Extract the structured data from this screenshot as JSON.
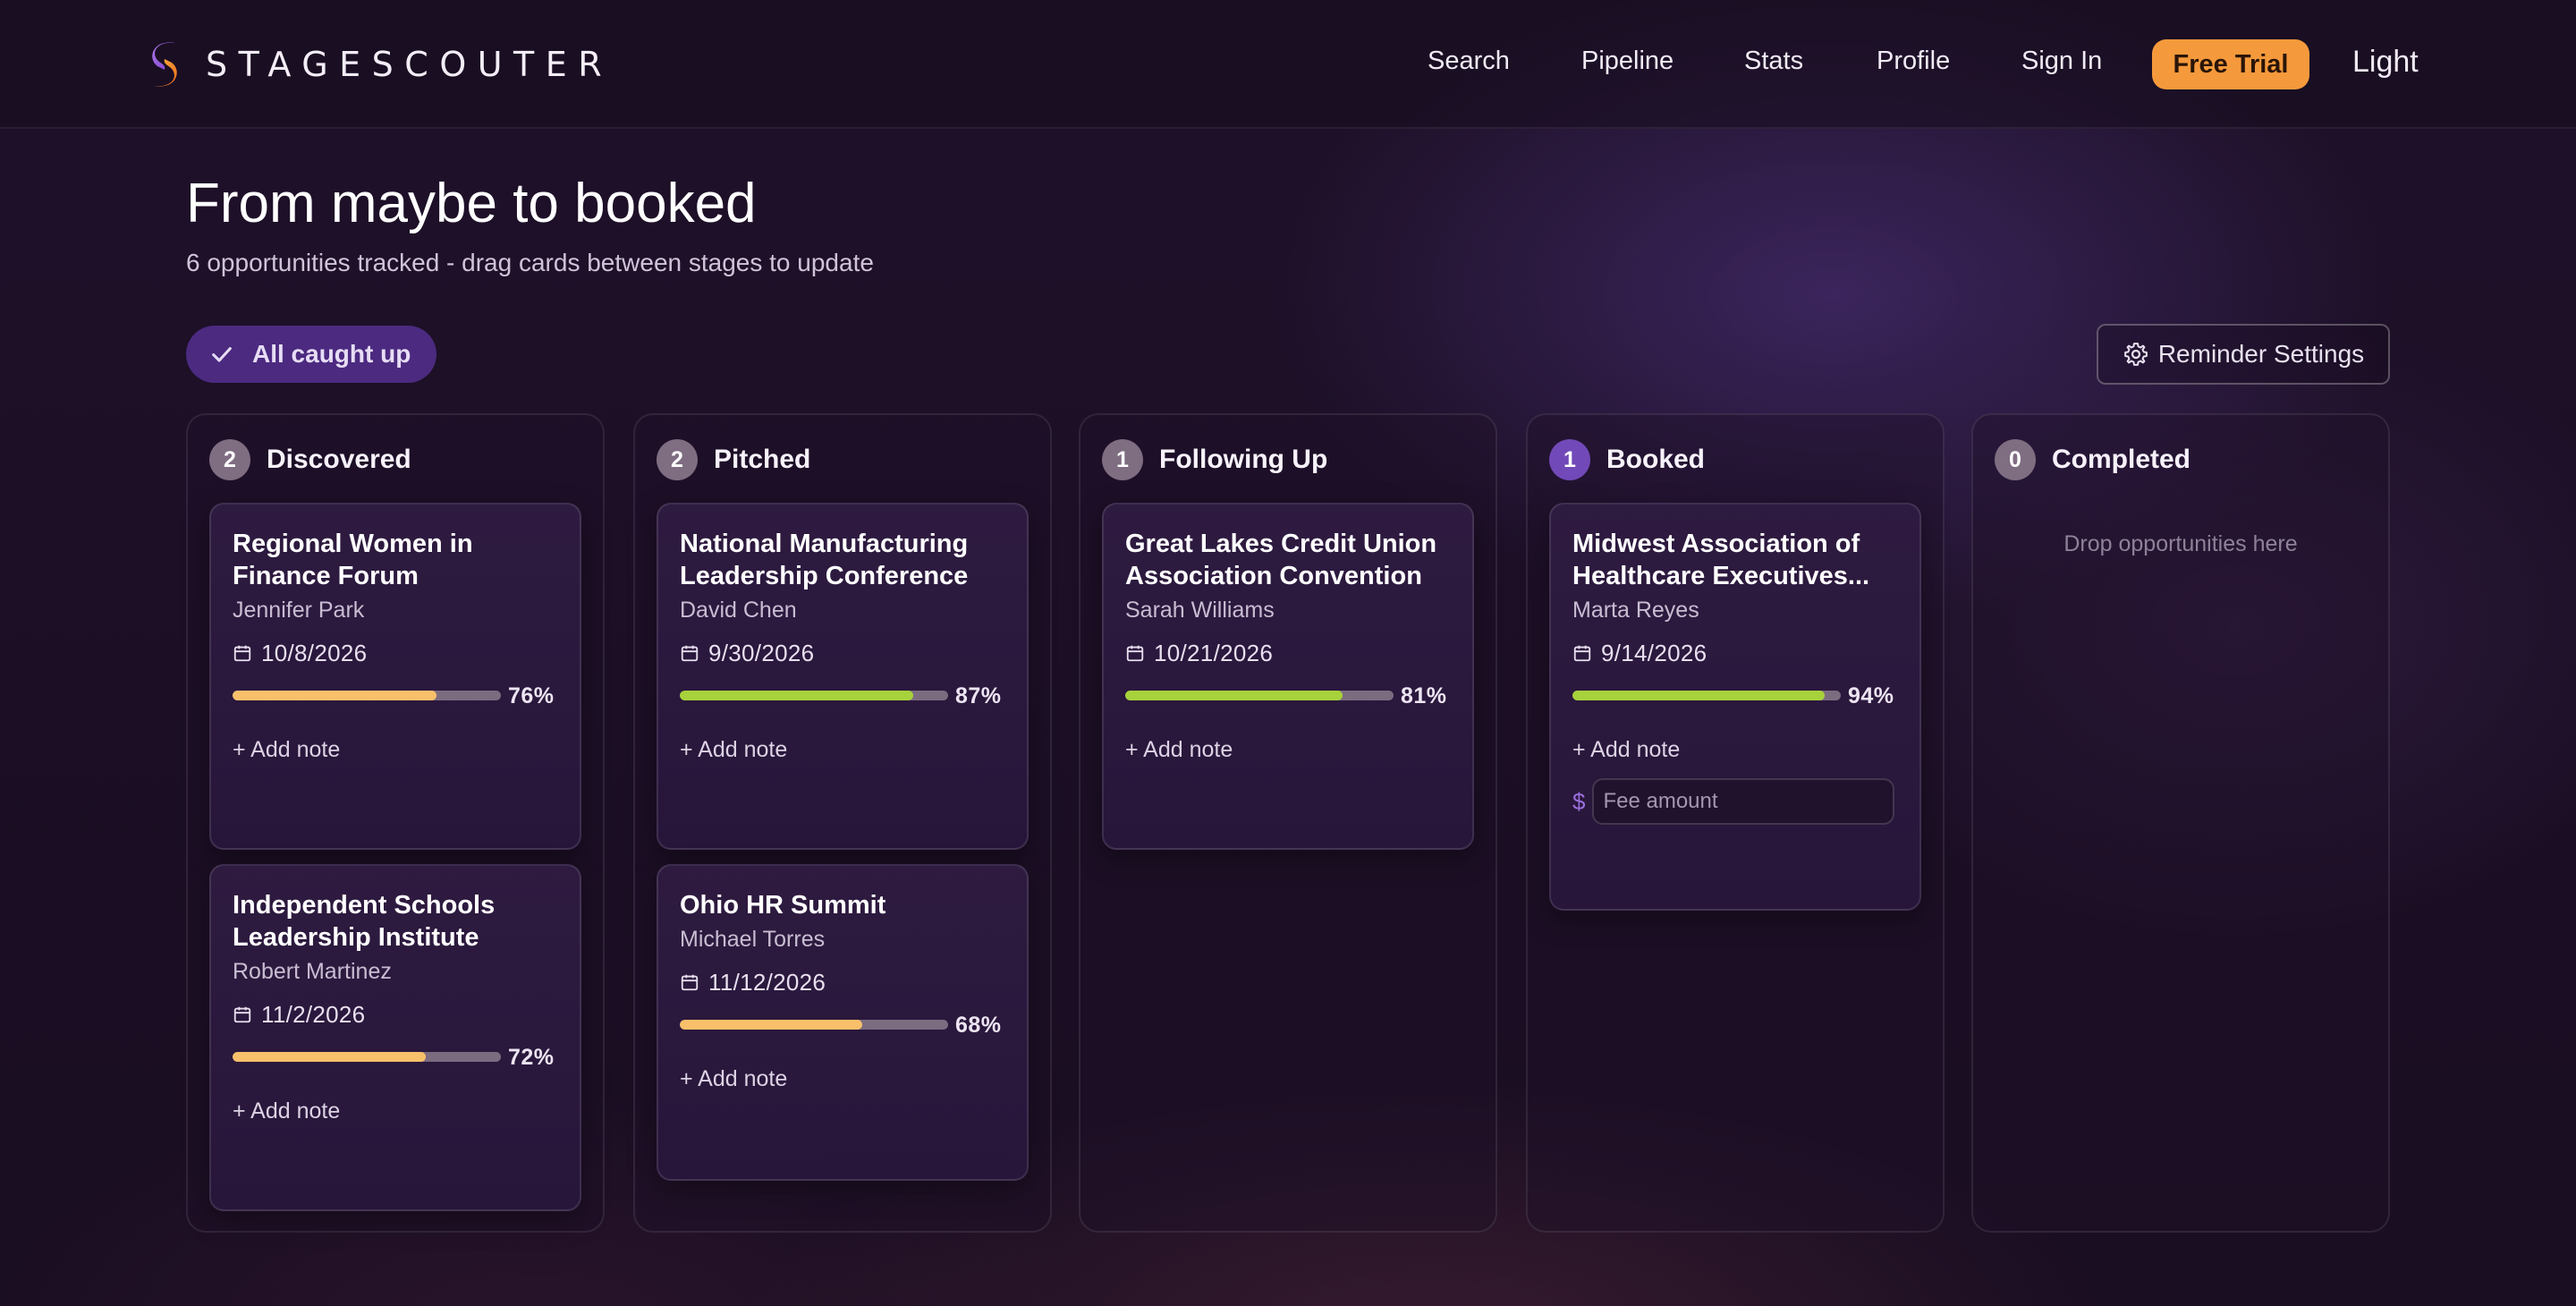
{
  "nav": {
    "brand": "STAGESCOUTER",
    "links": [
      "Search",
      "Pipeline",
      "Stats",
      "Profile",
      "Sign In"
    ],
    "cta": "Free Trial",
    "theme_toggle": "Light"
  },
  "header": {
    "title": "From maybe to booked",
    "subtitle": "6 opportunities tracked - drag cards between stages to update",
    "status_pill": "All caught up",
    "settings_button": "Reminder Settings"
  },
  "colors": {
    "accent_purple": "#7249b8",
    "cta_orange": "#f59a3c",
    "progress_high": "#a7d23b",
    "progress_mid": "#f8c06a"
  },
  "columns": [
    {
      "title": "Discovered",
      "count": "2",
      "cards": [
        {
          "title": "Regional Women in Finance Forum",
          "contact": "Jennifer Park",
          "date": "10/8/2026",
          "progress": 76,
          "progress_label": "76%",
          "add_note": "+ Add note"
        },
        {
          "title": "Independent Schools Leadership Institute",
          "contact": "Robert Martinez",
          "date": "11/2/2026",
          "progress": 72,
          "progress_label": "72%",
          "add_note": "+ Add note"
        }
      ]
    },
    {
      "title": "Pitched",
      "count": "2",
      "cards": [
        {
          "title": "National Manufacturing Leadership Conference",
          "contact": "David Chen",
          "date": "9/30/2026",
          "progress": 87,
          "progress_label": "87%",
          "add_note": "+ Add note"
        },
        {
          "title": "Ohio HR Summit",
          "contact": "Michael Torres",
          "date": "11/12/2026",
          "progress": 68,
          "progress_label": "68%",
          "add_note": "+ Add note"
        }
      ]
    },
    {
      "title": "Following Up",
      "count": "1",
      "cards": [
        {
          "title": "Great Lakes Credit Union Association Convention",
          "contact": "Sarah Williams",
          "date": "10/21/2026",
          "progress": 81,
          "progress_label": "81%",
          "add_note": "+ Add note"
        }
      ]
    },
    {
      "title": "Booked",
      "count": "1",
      "cards": [
        {
          "title": "Midwest Association of Healthcare Executives...",
          "contact": "Marta Reyes",
          "date": "9/14/2026",
          "progress": 94,
          "progress_label": "94%",
          "add_note": "+ Add note",
          "fee_symbol": "$",
          "fee_placeholder": "Fee amount"
        }
      ]
    },
    {
      "title": "Completed",
      "count": "0",
      "empty_text": "Drop opportunities here",
      "cards": []
    }
  ]
}
